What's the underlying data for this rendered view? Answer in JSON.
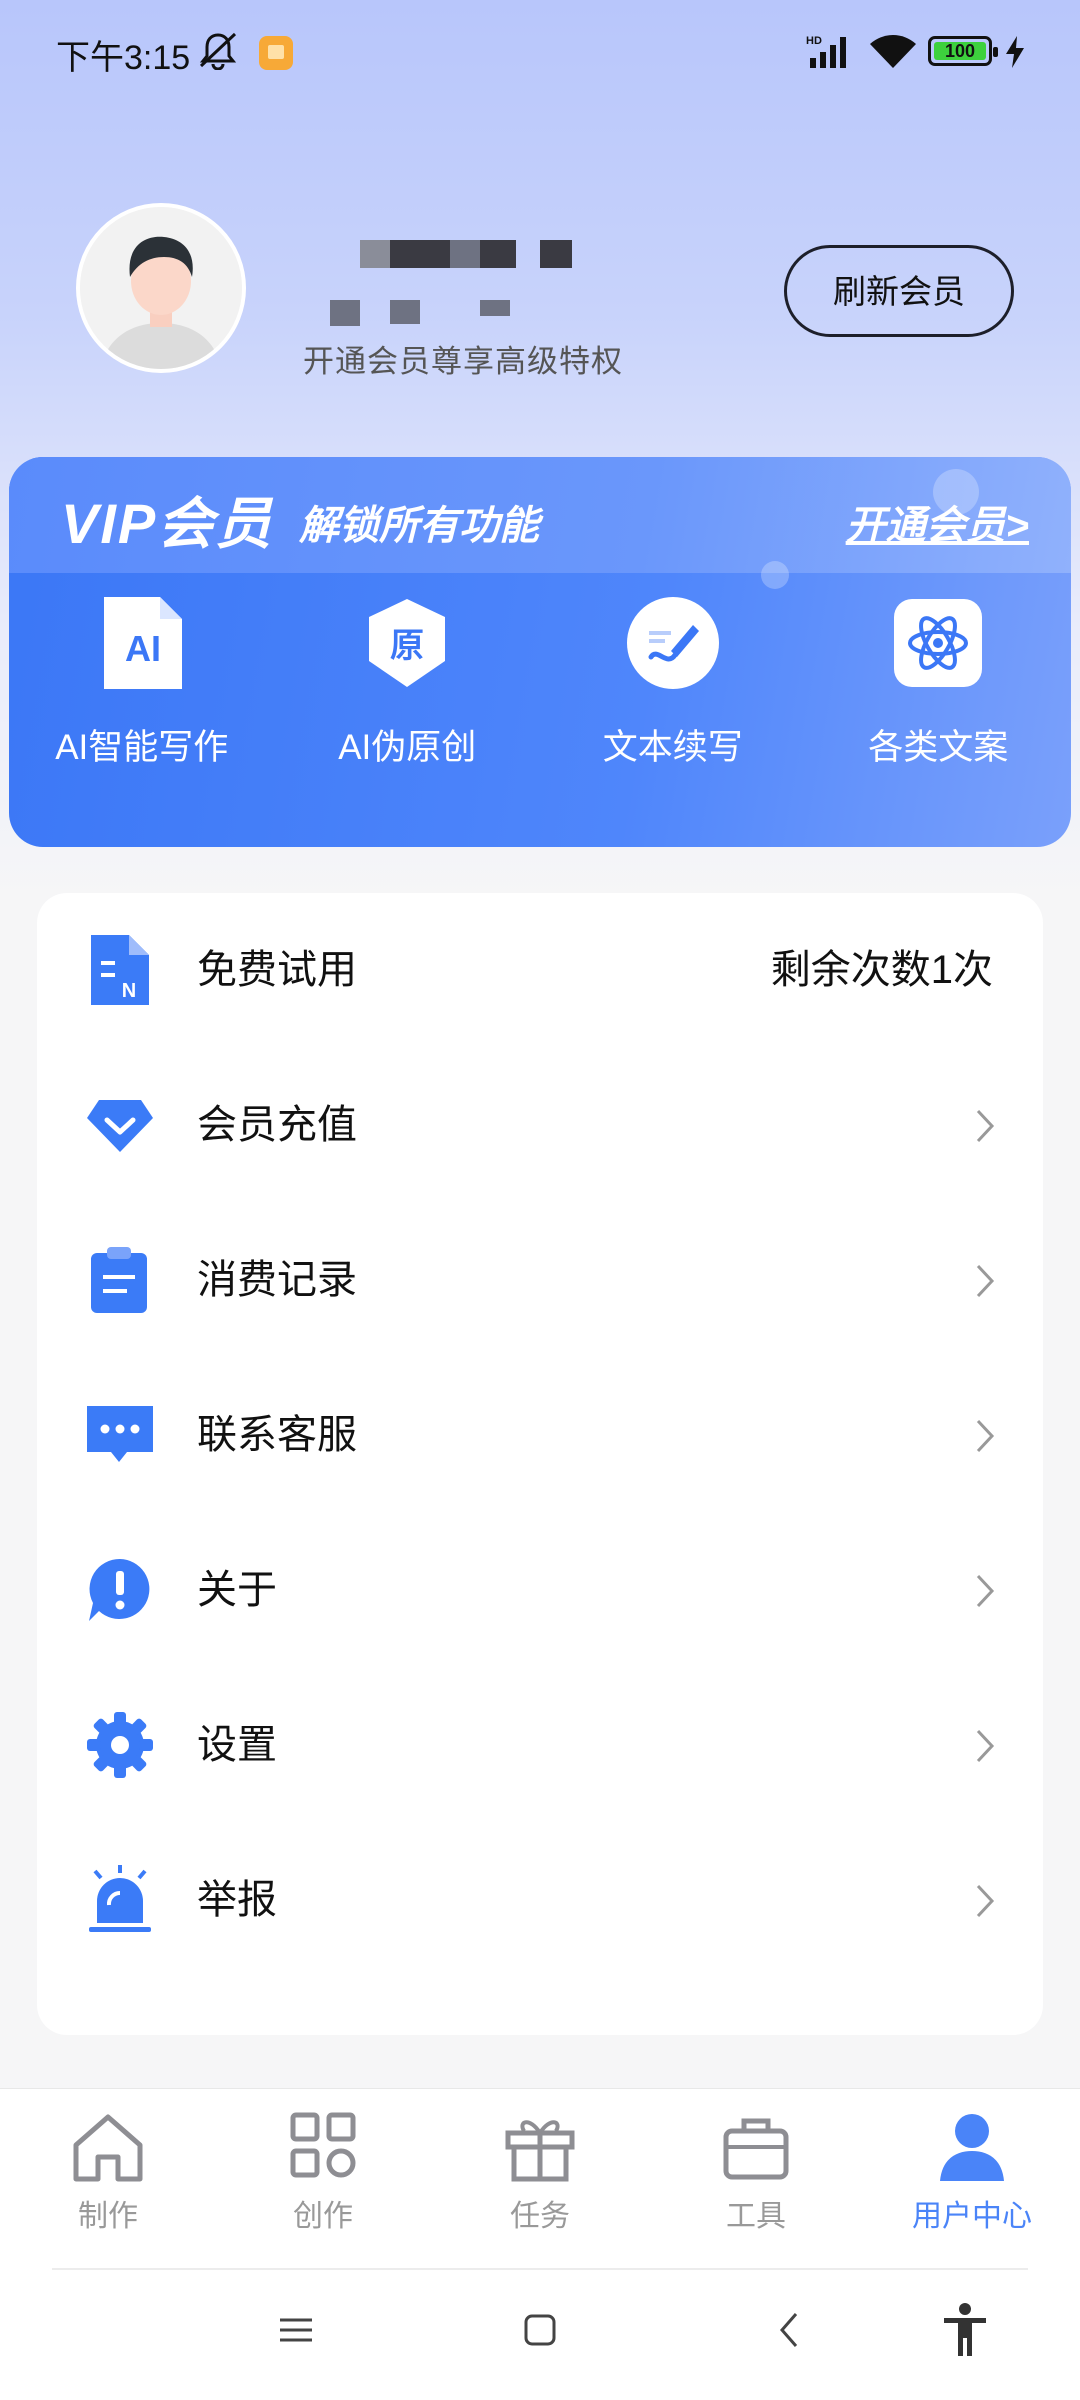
{
  "status_bar": {
    "time": "下午3:15",
    "battery": "100",
    "icons": [
      "mute-icon",
      "notification-icon",
      "hd-signal-icon",
      "wifi-icon",
      "battery-icon",
      "charging-icon"
    ]
  },
  "profile": {
    "subtitle": "开通会员尊享高级特权",
    "refresh_label": "刷新会员"
  },
  "vip": {
    "title": "VIP会员",
    "subtitle": "解锁所有功能",
    "open_label": "开通会员>",
    "features": [
      {
        "label": "AI智能写作",
        "icon": "ai-doc-icon"
      },
      {
        "label": "AI伪原创",
        "icon": "original-badge-icon"
      },
      {
        "label": "文本续写",
        "icon": "pen-icon"
      },
      {
        "label": "各类文案",
        "icon": "atom-icon"
      }
    ]
  },
  "menu": [
    {
      "label": "免费试用",
      "right": "剩余次数1次",
      "icon": "free-trial-icon"
    },
    {
      "label": "会员充值",
      "icon": "diamond-icon"
    },
    {
      "label": "消费记录",
      "icon": "clipboard-icon"
    },
    {
      "label": "联系客服",
      "icon": "chat-icon"
    },
    {
      "label": "关于",
      "icon": "info-icon"
    },
    {
      "label": "设置",
      "icon": "gear-icon"
    },
    {
      "label": "举报",
      "icon": "alarm-icon"
    }
  ],
  "tabs": [
    {
      "label": "制作",
      "icon": "home-icon"
    },
    {
      "label": "创作",
      "icon": "grid-icon"
    },
    {
      "label": "任务",
      "icon": "gift-icon"
    },
    {
      "label": "工具",
      "icon": "briefcase-icon"
    },
    {
      "label": "用户中心",
      "icon": "user-icon",
      "active": true
    }
  ],
  "colors": {
    "accent": "#4a84f8",
    "vip_card": "#3b77f6",
    "icon_blue": "#3b7bf7"
  }
}
